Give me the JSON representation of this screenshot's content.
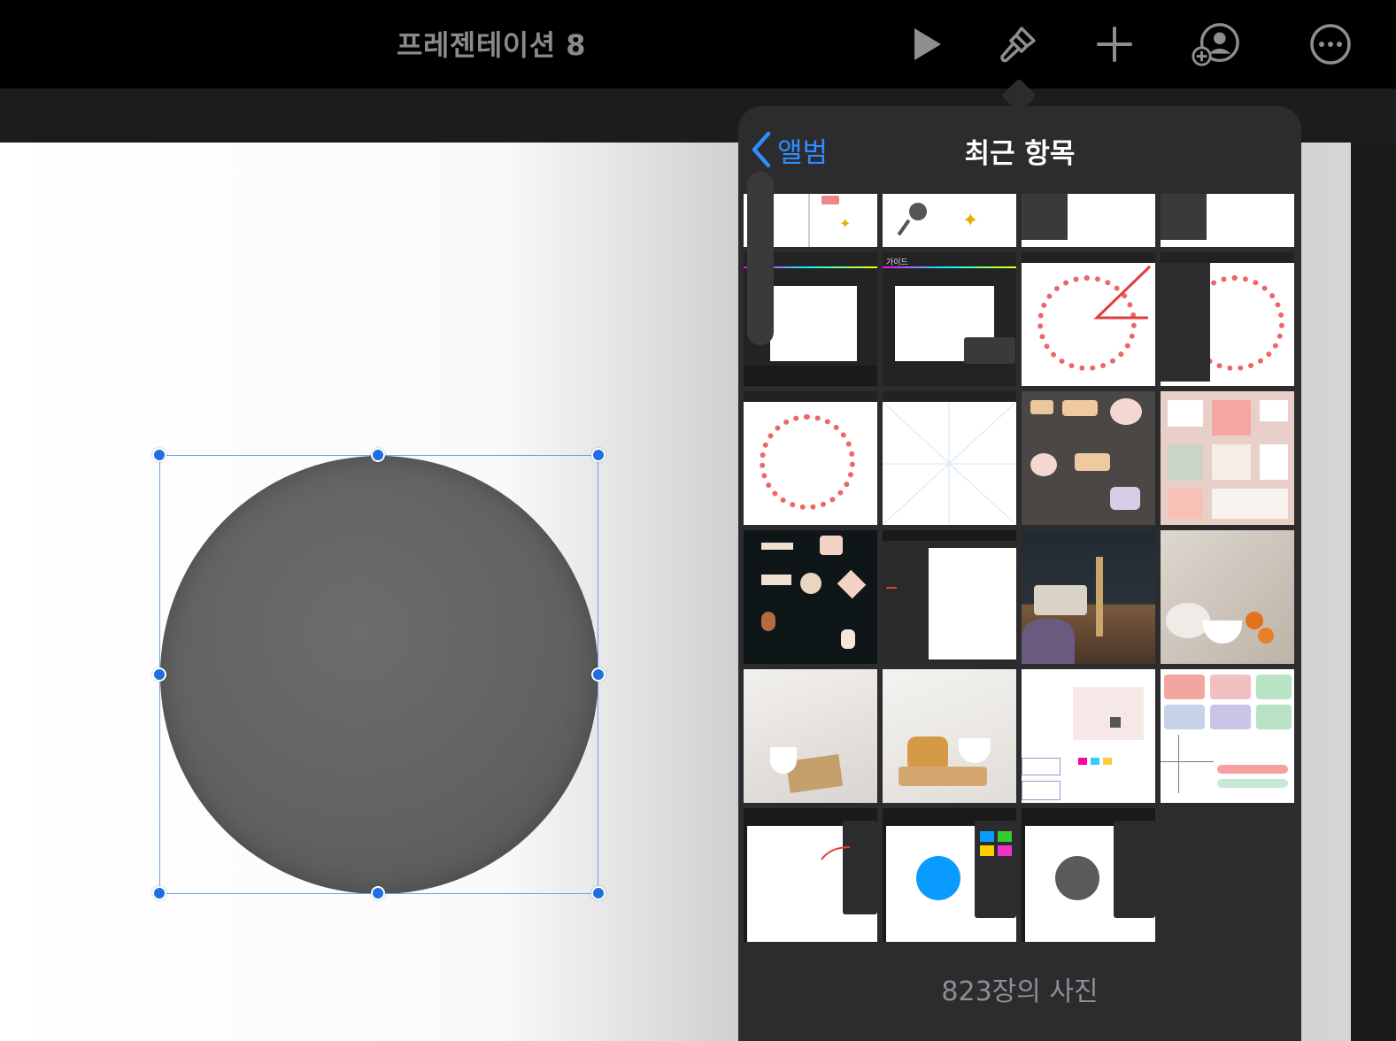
{
  "toolbar": {
    "title": "프레젠테이션 8",
    "icons": [
      "play-icon",
      "paintbrush-icon",
      "plus-icon",
      "collaborate-icon",
      "more-icon"
    ]
  },
  "popover": {
    "back_label": "앨범",
    "title": "최근 항목",
    "photo_count": "823장의 사진",
    "thumb_texts": {
      "guide": "가이드"
    }
  },
  "colors": {
    "accent": "#2f8cff",
    "handle": "#1f6fe0",
    "selection": "#6a9ef0",
    "popover_bg": "#2c2c2e",
    "toolbar_bg": "#000000"
  }
}
